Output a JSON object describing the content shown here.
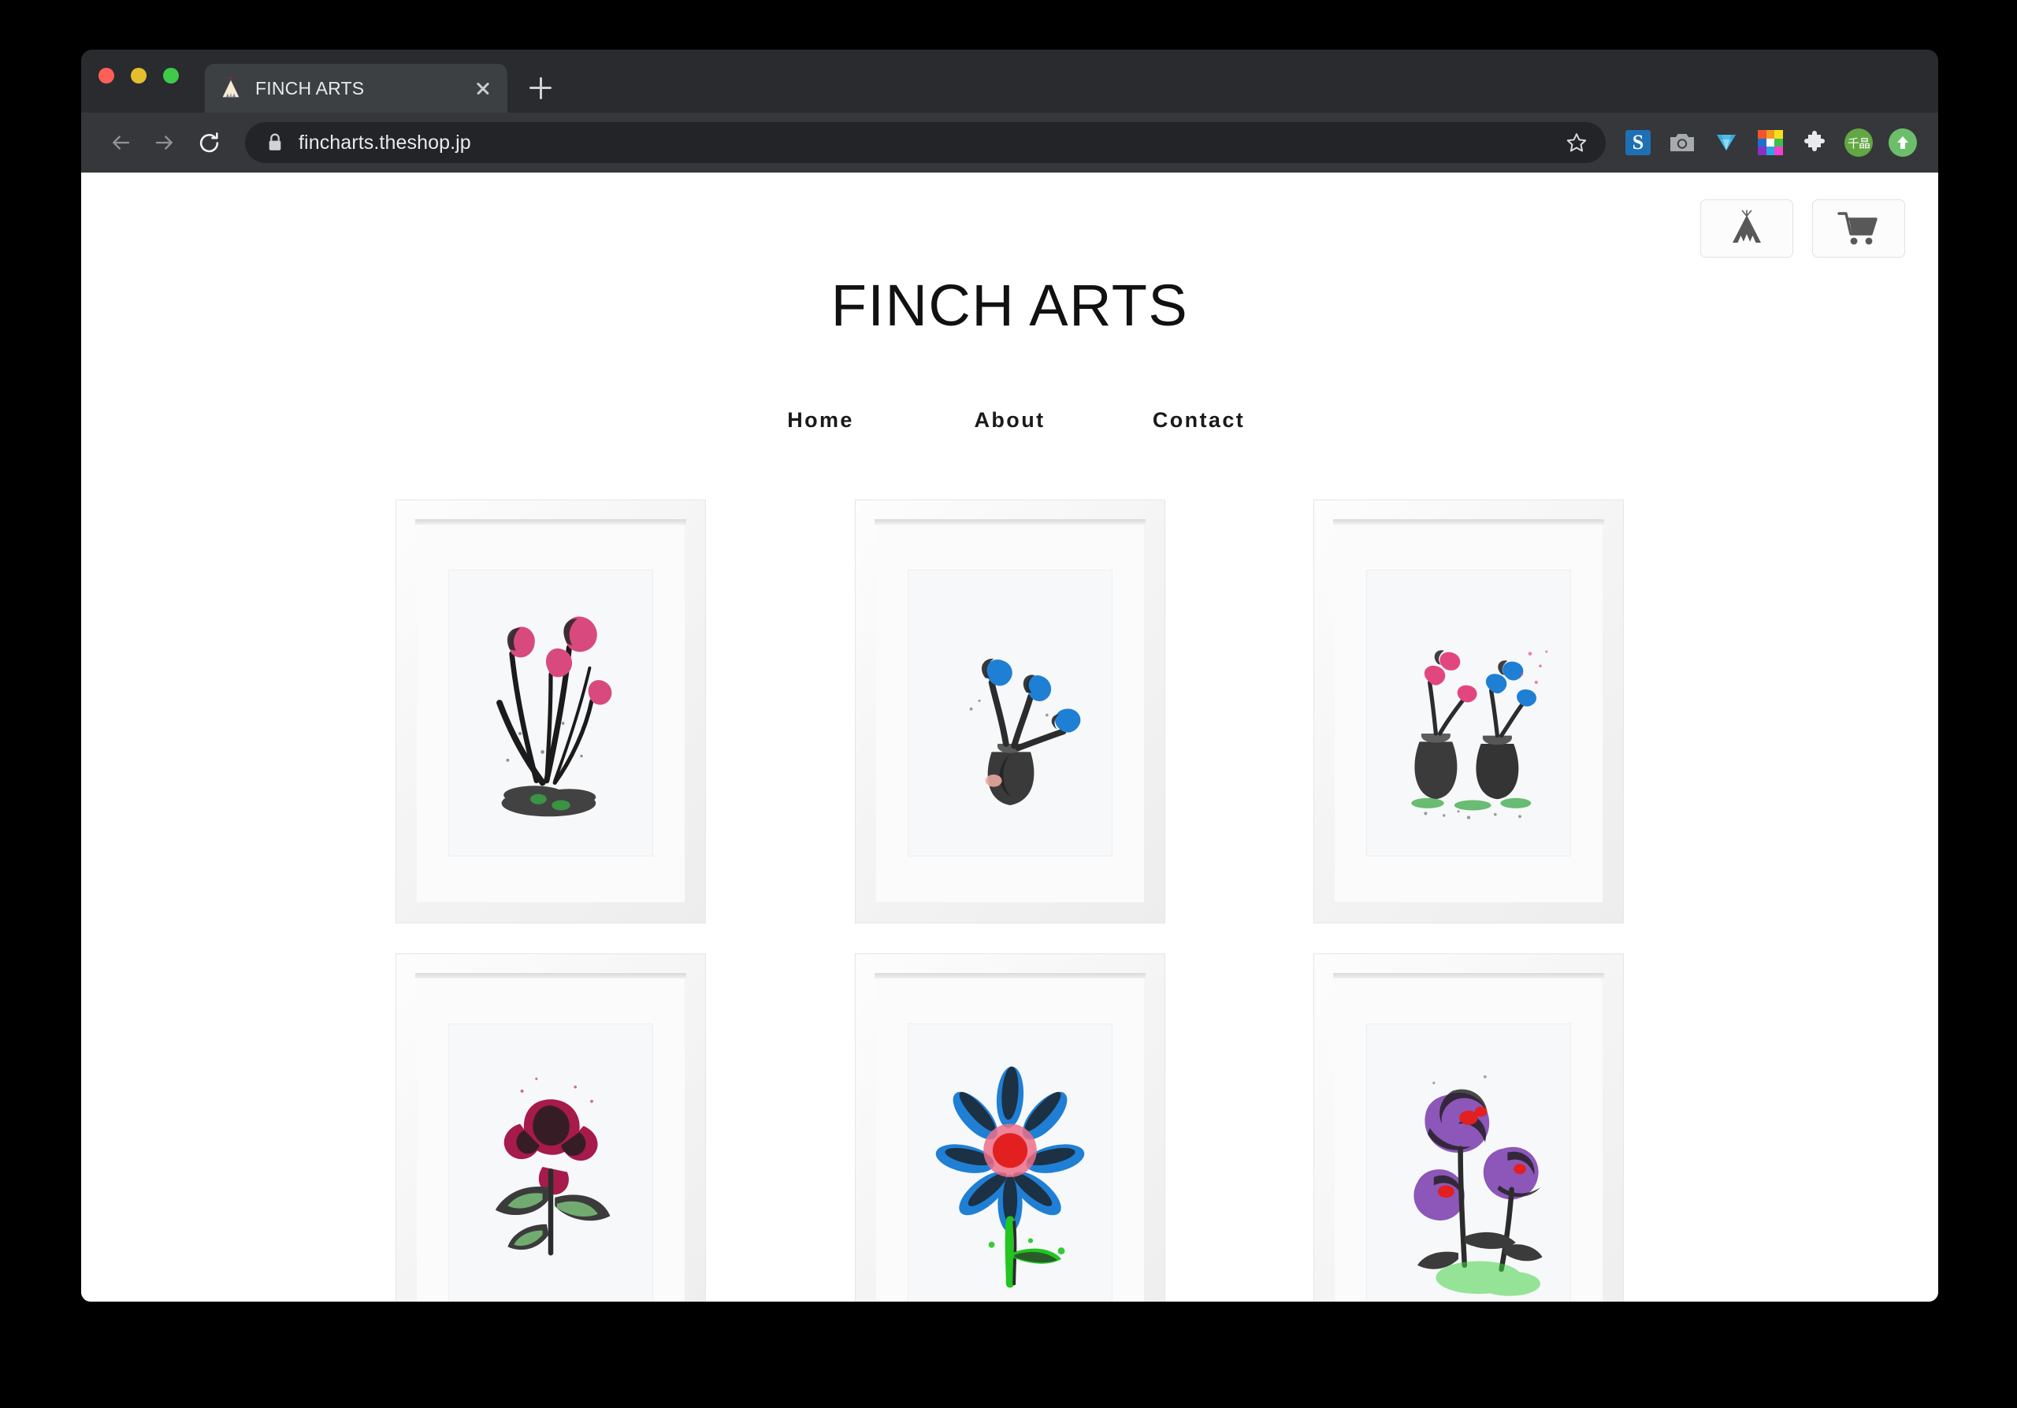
{
  "window": {
    "traffic_lights": [
      "close",
      "minimize",
      "maximize"
    ]
  },
  "browser": {
    "tab": {
      "title": "FINCH ARTS",
      "favicon": "teepee-icon",
      "close_label": "×"
    },
    "new_tab_label": "+",
    "toolbar": {
      "back": "back-arrow-icon",
      "forward": "forward-arrow-icon",
      "reload": "reload-icon",
      "lock": "lock-icon",
      "url": "fincharts.theshop.jp",
      "bookmark": "star-icon"
    },
    "extensions": [
      {
        "name": "s-extension-icon",
        "label": "S"
      },
      {
        "name": "camera-extension-icon",
        "label": ""
      },
      {
        "name": "diamond-extension-icon",
        "label": ""
      },
      {
        "name": "color-grid-extension-icon",
        "label": ""
      },
      {
        "name": "puzzle-extensions-icon",
        "label": ""
      },
      {
        "name": "profile-avatar-icon",
        "label": "千晶"
      },
      {
        "name": "upload-extension-icon",
        "label": ""
      }
    ]
  },
  "site": {
    "title": "FINCH ARTS",
    "header_buttons": [
      {
        "name": "teepee-home-button",
        "icon": "teepee-icon"
      },
      {
        "name": "cart-button",
        "icon": "cart-icon"
      }
    ],
    "nav": [
      {
        "label": "Home"
      },
      {
        "label": "About"
      },
      {
        "label": "Contact"
      }
    ],
    "gallery": [
      {
        "name": "artwork-pink-tulips",
        "description": "Pink tulips ink print",
        "flower_color": "#d84a7d",
        "accent_color": "#3aa845"
      },
      {
        "name": "artwork-blue-flowers-vase",
        "description": "Blue flowers in vase ink print",
        "flower_color": "#1f7fd4",
        "accent_color": "#e9a9a0"
      },
      {
        "name": "artwork-pink-blue-vases",
        "description": "Pink and blue flowers in two vases",
        "flower_color": "#e2467f",
        "accent_color": "#1f7fd4"
      },
      {
        "name": "artwork-crimson-flower",
        "description": "Crimson flower with green leaves",
        "flower_color": "#a61b4a",
        "accent_color": "#7bbf7a"
      },
      {
        "name": "artwork-blue-daisy",
        "description": "Blue daisy with red centre",
        "flower_color": "#1f7fd4",
        "accent_color": "#21c621"
      },
      {
        "name": "artwork-purple-flowers",
        "description": "Purple flowers with red centres",
        "flower_color": "#8c57b8",
        "accent_color": "#46d246"
      }
    ]
  },
  "colors": {
    "page_bg": "#ffffff",
    "chrome_bg": "#292b2e",
    "toolbar_bg": "#35373a",
    "omnibox_bg": "#232427",
    "text_light": "#e8eaed",
    "traffic_red": "#ff5f57",
    "traffic_yellow": "#e5bd2e",
    "traffic_green": "#3fca49"
  }
}
